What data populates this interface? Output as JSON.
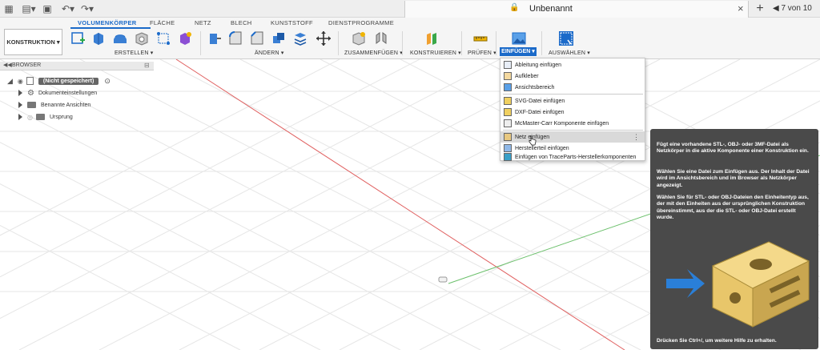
{
  "titlebar": {
    "doc_title": "Unbenannt",
    "pages": "7 von 10",
    "close": "×",
    "plus": "+"
  },
  "toolbar": {
    "workspace": "KONSTRUKTION ▾",
    "tabs": [
      "VOLUMENKÖRPER",
      "FLÄCHE",
      "NETZ",
      "BLECH",
      "KUNSTSTOFF",
      "DIENSTPROGRAMME"
    ],
    "groups": {
      "erstellen": "ERSTELLEN ▾",
      "aendern": "ÄNDERN ▾",
      "zusammenfuegen": "ZUSAMMENFÜGEN ▾",
      "konstruieren": "KONSTRUIEREN ▾",
      "pruefen": "PRÜFEN ▾",
      "einfuegen": "EINFÜGEN ▾",
      "auswaehlen": "AUSWÄHLEN ▾"
    }
  },
  "browser": {
    "title": "BROWSER",
    "root": "(Nicht gespeichert)",
    "items": [
      "Dokumenteinstellungen",
      "Benannte Ansichten",
      "Ursprung"
    ]
  },
  "menu": {
    "items": [
      "Ableitung einfügen",
      "Aufkleber",
      "Ansichtsbereich",
      "SVG-Datei einfügen",
      "DXF-Datei einfügen",
      "McMaster-Carr Komponente einfügen",
      "Netz einfügen",
      "Herstellerteil einfügen",
      "Einfügen von TraceParts-Herstellerkomponenten"
    ],
    "more": "⋮"
  },
  "tooltip": {
    "p1": "Fügt eine vorhandene STL-, OBJ- oder 3MF-Datei als Netzkörper in die aktive Komponente einer Konstruktion ein.",
    "p2": "Wählen Sie eine Datei zum Einfügen aus. Der Inhalt der Datei wird im Ansichtsbereich und im Browser als Netzkörper angezeigt.",
    "p3": "Wählen Sie für STL- oder OBJ-Dateien den Einheitentyp aus, der mit den Einheiten aus der ursprünglichen Konstruktion übereinstimmt, aus der die STL- oder OBJ-Datei erstellt wurde.",
    "footer": "Drücken Sie Ctrl+/, um weitere Hilfe zu erhalten."
  },
  "colors": {
    "accent": "#1b6ac9",
    "x_axis": "#e06060",
    "y_axis": "#6cc06c",
    "tooltip_bg": "#4a4a4a"
  }
}
